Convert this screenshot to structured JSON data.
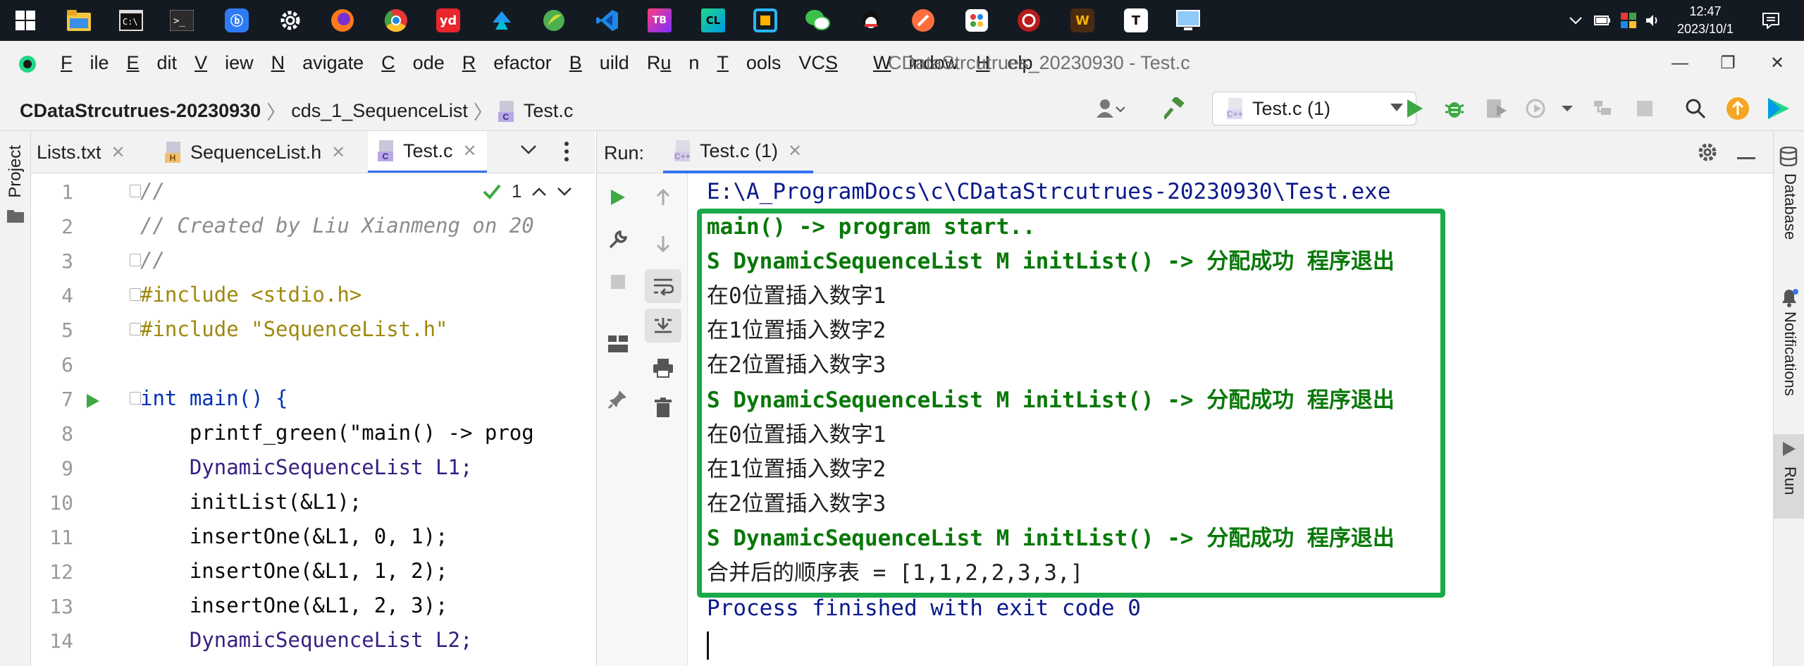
{
  "taskbar": {
    "apps": [
      {
        "name": "windows-start-icon"
      },
      {
        "name": "file-explorer-icon"
      },
      {
        "name": "command-prompt-icon"
      },
      {
        "name": "powershell-icon"
      },
      {
        "name": "baidu-netdisk-icon"
      },
      {
        "name": "settings-icon"
      },
      {
        "name": "firefox-icon"
      },
      {
        "name": "chrome-icon"
      },
      {
        "name": "youdao-dictionary-icon",
        "label": "yd"
      },
      {
        "name": "multi-color-app-icon"
      },
      {
        "name": "green-app-icon"
      },
      {
        "name": "vscode-icon"
      },
      {
        "name": "jetbrains-toolbox-icon"
      },
      {
        "name": "clion-icon",
        "label": "CL"
      },
      {
        "name": "blue-square-app-icon"
      },
      {
        "name": "wechat-icon"
      },
      {
        "name": "qq-icon"
      },
      {
        "name": "orange-app-icon"
      },
      {
        "name": "baidu-app-icon"
      },
      {
        "name": "red-circle-app-icon"
      },
      {
        "name": "wps-icon",
        "label": "W"
      },
      {
        "name": "typora-icon",
        "label": "T"
      },
      {
        "name": "monitor-app-icon"
      }
    ],
    "clock": {
      "time": "12:47",
      "date": "2023/10/1"
    }
  },
  "menubar": {
    "items": [
      "File",
      "Edit",
      "View",
      "Navigate",
      "Code",
      "Refactor",
      "Build",
      "Run",
      "Tools",
      "VCS",
      "Window",
      "Help"
    ],
    "window_title": "CDataStrcutrues_20230930 - Test.c"
  },
  "navbar": {
    "breadcrumb": [
      "CDataStrcutrues-20230930",
      "cds_1_SequenceList",
      "Test.c"
    ],
    "run_config": "Test.c (1)"
  },
  "left_strip": {
    "project_label": "Project"
  },
  "editor": {
    "tabs": [
      {
        "label": "Lists.txt",
        "active": false
      },
      {
        "label": "SequenceList.h",
        "active": false
      },
      {
        "label": "Test.c",
        "active": true
      }
    ],
    "inspection_count": "1",
    "lines": [
      {
        "n": "1",
        "text": "//"
      },
      {
        "n": "2",
        "text": "// Created by Liu Xianmeng on 20"
      },
      {
        "n": "3",
        "text": "//"
      },
      {
        "n": "4",
        "text": "#include <stdio.h>"
      },
      {
        "n": "5",
        "text": "#include \"SequenceList.h\""
      },
      {
        "n": "6",
        "text": ""
      },
      {
        "n": "7",
        "text": "int main() {"
      },
      {
        "n": "8",
        "text": "    printf_green(\"main() -> prog"
      },
      {
        "n": "9",
        "text": "    DynamicSequenceList L1;"
      },
      {
        "n": "10",
        "text": "    initList(&L1);"
      },
      {
        "n": "11",
        "text": "    insertOne(&L1, 0, 1);"
      },
      {
        "n": "12",
        "text": "    insertOne(&L1, 1, 2);"
      },
      {
        "n": "13",
        "text": "    insertOne(&L1, 2, 3);"
      },
      {
        "n": "14",
        "text": "    DynamicSequenceList L2;"
      }
    ]
  },
  "run": {
    "label": "Run:",
    "tab_label": "Test.c (1)",
    "console": [
      {
        "text": "E:\\A_ProgramDocs\\c\\CDataStrcutrues-20230930\\Test.exe",
        "style": "path"
      },
      {
        "text": "main() -> program start..",
        "style": "green"
      },
      {
        "text": "S DynamicSequenceList M initList() -> 分配成功 程序退出",
        "style": "green"
      },
      {
        "text": "在0位置插入数字1",
        "style": "plain"
      },
      {
        "text": "在1位置插入数字2",
        "style": "plain"
      },
      {
        "text": "在2位置插入数字3",
        "style": "plain"
      },
      {
        "text": "S DynamicSequenceList M initList() -> 分配成功 程序退出",
        "style": "green"
      },
      {
        "text": "在0位置插入数字1",
        "style": "plain"
      },
      {
        "text": "在1位置插入数字2",
        "style": "plain"
      },
      {
        "text": "在2位置插入数字3",
        "style": "plain"
      },
      {
        "text": "S DynamicSequenceList M initList() -> 分配成功 程序退出",
        "style": "green"
      },
      {
        "text": "合并后的顺序表 = [1,1,2,2,3,3,]",
        "style": "plain"
      },
      {
        "text": "Process finished with exit code 0",
        "style": "exit"
      }
    ]
  },
  "right_strip": {
    "database_label": "Database",
    "notifications_label": "Notifications",
    "run_label": "Run"
  },
  "colors": {
    "highlight_box": "#1aa94a",
    "accent": "#3574f0",
    "console_green": "#087808",
    "console_path": "#0b1a8a"
  }
}
